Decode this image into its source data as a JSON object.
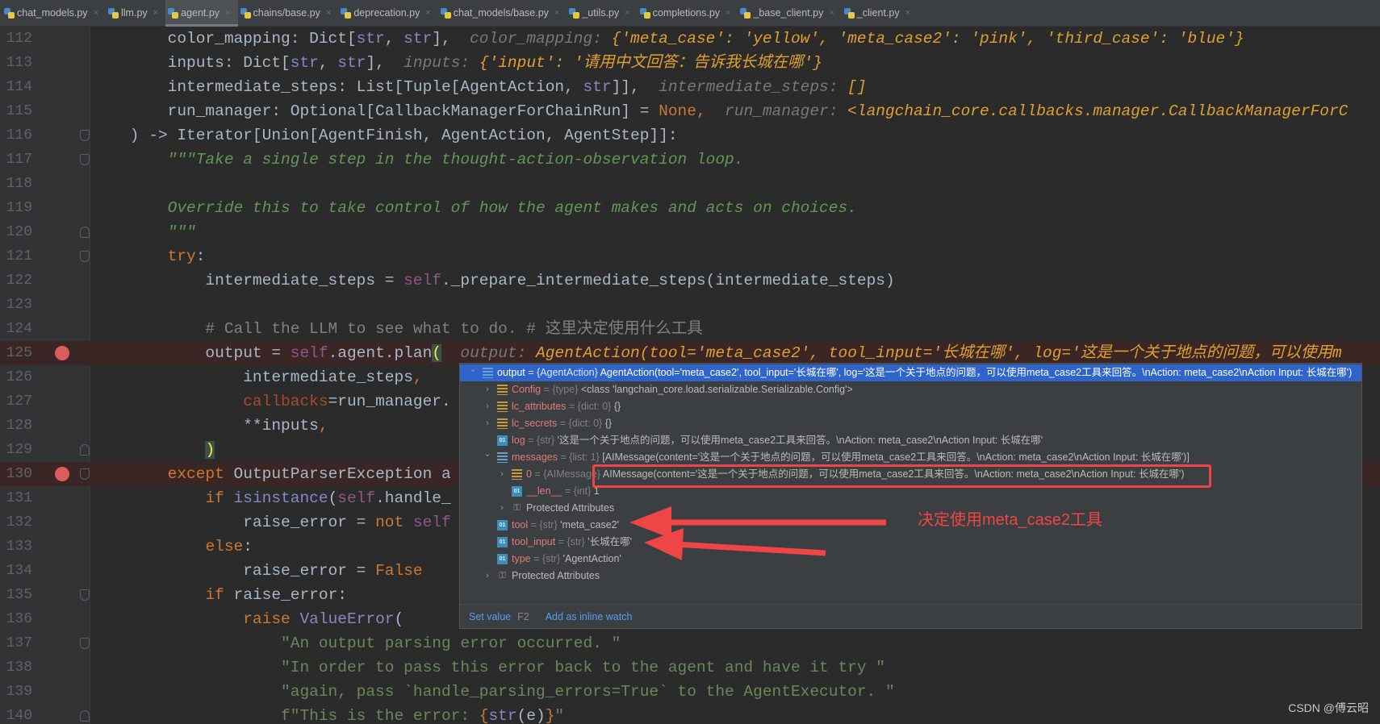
{
  "tabs": [
    {
      "label": "chat_models.py",
      "active": false
    },
    {
      "label": "llm.py",
      "active": false
    },
    {
      "label": "agent.py",
      "active": true
    },
    {
      "label": "chains/base.py",
      "active": false
    },
    {
      "label": "deprecation.py",
      "active": false
    },
    {
      "label": "chat_models/base.py",
      "active": false
    },
    {
      "label": "_utils.py",
      "active": false
    },
    {
      "label": "completions.py",
      "active": false
    },
    {
      "label": "_base_client.py",
      "active": false
    },
    {
      "label": "_client.py",
      "active": false
    }
  ],
  "tab_close_glyph": "×",
  "editor": {
    "lines": [
      {
        "num": "112",
        "segs": [
          [
            "        color_mapping: Dict[",
            "d"
          ],
          [
            "str",
            "b"
          ],
          [
            ", ",
            "d"
          ],
          [
            "str",
            "b"
          ],
          [
            "],",
            "d"
          ],
          [
            "  color_mapping: ",
            "h"
          ],
          [
            "{'meta_case': 'yellow', 'meta_case2': 'pink', 'third_case': 'blue'}",
            "hv"
          ]
        ]
      },
      {
        "num": "113",
        "segs": [
          [
            "        inputs: Dict[",
            "d"
          ],
          [
            "str",
            "b"
          ],
          [
            ", ",
            "d"
          ],
          [
            "str",
            "b"
          ],
          [
            "],",
            "d"
          ],
          [
            "  inputs: ",
            "h"
          ],
          [
            "{'input': '请用中文回答：告诉我长城在哪'}",
            "hv"
          ]
        ]
      },
      {
        "num": "114",
        "segs": [
          [
            "        intermediate_steps: List[Tuple[AgentAction, ",
            "d"
          ],
          [
            "str",
            "b"
          ],
          [
            "]],",
            "d"
          ],
          [
            "  intermediate_steps: ",
            "h"
          ],
          [
            "[]",
            "hv"
          ]
        ]
      },
      {
        "num": "115",
        "segs": [
          [
            "        run_manager: Optional[CallbackManagerForChainRun] = ",
            "d"
          ],
          [
            "None",
            "k"
          ],
          [
            ",",
            "k"
          ],
          [
            "  run_manager: ",
            "h"
          ],
          [
            "<langchain_core.callbacks.manager.CallbackManagerForC",
            "hv"
          ]
        ]
      },
      {
        "num": "116",
        "fold": "down",
        "segs": [
          [
            "    ) -> Iterator[Union[AgentFinish, AgentAction, AgentStep]]:",
            "d"
          ]
        ]
      },
      {
        "num": "117",
        "fold": "down",
        "segs": [
          [
            "        \"\"\"Take a single step in the thought-action-observation loop.",
            "doc"
          ]
        ]
      },
      {
        "num": "118",
        "segs": []
      },
      {
        "num": "119",
        "segs": [
          [
            "        Override this to take control of how the agent makes and acts on choices.",
            "doc"
          ]
        ]
      },
      {
        "num": "120",
        "fold": "up",
        "segs": [
          [
            "        \"\"\"",
            "doc"
          ]
        ]
      },
      {
        "num": "121",
        "fold": "down",
        "segs": [
          [
            "        ",
            "d"
          ],
          [
            "try",
            "k"
          ],
          [
            ":",
            "d"
          ]
        ]
      },
      {
        "num": "122",
        "segs": [
          [
            "            intermediate_steps = ",
            "d"
          ],
          [
            "self",
            "s"
          ],
          [
            "._prepare_intermediate_steps(intermediate_steps)",
            "d"
          ]
        ]
      },
      {
        "num": "123",
        "segs": []
      },
      {
        "num": "124",
        "segs": [
          [
            "            # Call the LLM to see what to do. # 这里决定使用什么工具",
            "cm"
          ]
        ]
      },
      {
        "num": "125",
        "breakpoint": true,
        "segs": [
          [
            "            output = ",
            "d"
          ],
          [
            "self",
            "s"
          ],
          [
            ".agent.plan",
            "d"
          ],
          [
            "(",
            "m"
          ],
          [
            "  output: ",
            "h"
          ],
          [
            "AgentAction(tool='meta_case2', tool_input='长城在哪', log='这是一个关于地点的问题，可以使用m",
            "hv"
          ]
        ]
      },
      {
        "num": "126",
        "segs": [
          [
            "                intermediate_steps",
            "d"
          ],
          [
            ",",
            "k"
          ]
        ]
      },
      {
        "num": "127",
        "segs": [
          [
            "                ",
            "d"
          ],
          [
            "callbacks",
            "p"
          ],
          [
            "=run_manager.",
            "d"
          ]
        ]
      },
      {
        "num": "128",
        "segs": [
          [
            "                **inputs",
            "d"
          ],
          [
            ",",
            "k"
          ]
        ]
      },
      {
        "num": "129",
        "fold": "up",
        "segs": [
          [
            "            ",
            "d"
          ],
          [
            ")",
            "m"
          ]
        ]
      },
      {
        "num": "130",
        "breakpoint": true,
        "fold": "down",
        "segs": [
          [
            "        ",
            "d"
          ],
          [
            "except ",
            "k"
          ],
          [
            "OutputParserException a",
            "d"
          ]
        ]
      },
      {
        "num": "131",
        "segs": [
          [
            "            ",
            "d"
          ],
          [
            "if ",
            "k"
          ],
          [
            "isinstance",
            "b"
          ],
          [
            "(",
            "d"
          ],
          [
            "self",
            "s"
          ],
          [
            ".handle_",
            "d"
          ]
        ]
      },
      {
        "num": "132",
        "segs": [
          [
            "                raise_error = ",
            "d"
          ],
          [
            "not ",
            "k"
          ],
          [
            "self",
            "s"
          ]
        ]
      },
      {
        "num": "133",
        "segs": [
          [
            "            ",
            "d"
          ],
          [
            "else",
            "k"
          ],
          [
            ":",
            "d"
          ]
        ]
      },
      {
        "num": "134",
        "segs": [
          [
            "                raise_error = ",
            "d"
          ],
          [
            "False",
            "k"
          ]
        ]
      },
      {
        "num": "135",
        "fold": "down",
        "segs": [
          [
            "            ",
            "d"
          ],
          [
            "if ",
            "k"
          ],
          [
            "raise_error:",
            "d"
          ]
        ]
      },
      {
        "num": "136",
        "segs": [
          [
            "                ",
            "d"
          ],
          [
            "raise ",
            "k"
          ],
          [
            "ValueError",
            "b"
          ],
          [
            "(",
            "d"
          ]
        ]
      },
      {
        "num": "137",
        "fold": "down",
        "segs": [
          [
            "                    \"An output parsing error occurred. \"",
            "str"
          ]
        ]
      },
      {
        "num": "138",
        "segs": [
          [
            "                    \"In order to pass this error back to the agent and have it try \"",
            "str"
          ]
        ]
      },
      {
        "num": "139",
        "segs": [
          [
            "                    \"again, pass `handle_parsing_errors=True` to the AgentExecutor. \"",
            "str"
          ]
        ]
      },
      {
        "num": "140",
        "fold": "up",
        "segs": [
          [
            "                    f\"This is the error: ",
            "str"
          ],
          [
            "{",
            "k"
          ],
          [
            "str",
            "b"
          ],
          [
            "(e)",
            "d"
          ],
          [
            "}",
            "k"
          ],
          [
            "\"",
            "str"
          ]
        ]
      }
    ]
  },
  "debugger_popup": {
    "rows": [
      {
        "level": 0,
        "chevron": "expanded",
        "icon": "list",
        "name": "output",
        "type": "{AgentAction}",
        "value": "AgentAction(tool='meta_case2', tool_input='长城在哪', log='这是一个关于地点的问题，可以使用meta_case2工具来回答。\\nAction: meta_case2\\nAction Input: 长城在哪')",
        "selected": true
      },
      {
        "level": 1,
        "chevron": "collapsed",
        "icon": "field",
        "name": "Config",
        "type": "{type}",
        "value": "<class 'langchain_core.load.serializable.Serializable.Config'>"
      },
      {
        "level": 1,
        "chevron": "collapsed",
        "icon": "field",
        "name": "lc_attributes",
        "type": "{dict: 0}",
        "value": "{}"
      },
      {
        "level": 1,
        "chevron": "collapsed",
        "icon": "field",
        "name": "lc_secrets",
        "type": "{dict: 0}",
        "value": "{}"
      },
      {
        "level": 1,
        "chevron": "none",
        "icon": "str",
        "name": "log",
        "type": "{str}",
        "value": "'这是一个关于地点的问题，可以使用meta_case2工具来回答。\\nAction: meta_case2\\nAction Input: 长城在哪'"
      },
      {
        "level": 1,
        "chevron": "expanded",
        "icon": "list",
        "name": "messages",
        "type": "{list: 1}",
        "value": "[AIMessage(content='这是一个关于地点的问题，可以使用meta_case2工具来回答。\\nAction: meta_case2\\nAction Input: 长城在哪')]"
      },
      {
        "level": 2,
        "chevron": "collapsed",
        "icon": "field",
        "name": "0",
        "type": "{AIMessage}",
        "value": "AIMessage(content='这是一个关于地点的问题，可以使用meta_case2工具来回答。\\nAction: meta_case2\\nAction Input: 长城在哪')"
      },
      {
        "level": 2,
        "chevron": "none",
        "icon": "str",
        "name": "__len__",
        "type": "{int}",
        "value": "1"
      },
      {
        "level": 2,
        "chevron": "collapsed",
        "icon": "key",
        "name": "Protected Attributes",
        "type": "",
        "value": "",
        "plain": true
      },
      {
        "level": 1,
        "chevron": "none",
        "icon": "str",
        "name": "tool",
        "type": "{str}",
        "value": "'meta_case2'"
      },
      {
        "level": 1,
        "chevron": "none",
        "icon": "str",
        "name": "tool_input",
        "type": "{str}",
        "value": "'长城在哪'"
      },
      {
        "level": 1,
        "chevron": "none",
        "icon": "str",
        "name": "type",
        "type": "{str}",
        "value": "'AgentAction'"
      },
      {
        "level": 1,
        "chevron": "collapsed",
        "icon": "key",
        "name": "Protected Attributes",
        "type": "",
        "value": "",
        "plain": true
      }
    ],
    "footer": {
      "set_value": "Set value",
      "set_value_key": "F2",
      "add_watch": "Add as inline watch"
    }
  },
  "annotation": {
    "text": "决定使用meta_case2工具",
    "color": "#f04545"
  },
  "watermark": "CSDN @傅云昭"
}
